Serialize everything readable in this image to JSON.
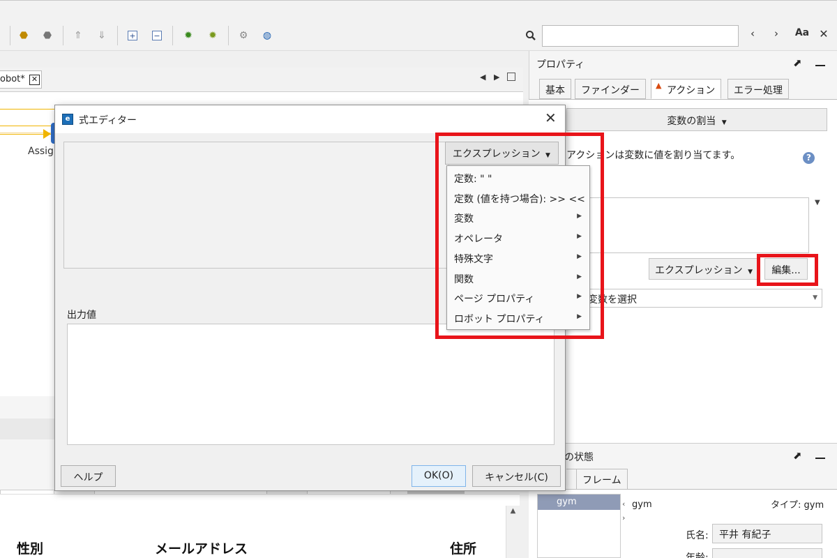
{
  "toolbar": {
    "search_value": "",
    "case_label": "Aa"
  },
  "editor": {
    "tab_label": "obot*",
    "tab_close": "✕",
    "assign_label": "Assig"
  },
  "table": {
    "headers": [
      "性別",
      "メールアドレス",
      "住所"
    ]
  },
  "properties": {
    "title": "プロパティ",
    "tabs": [
      "基本",
      "ファインダー",
      "アクション",
      "エラー処理"
    ],
    "action_dropdown": "変数の割当",
    "description": "アクションは変数に値を割り当てます。",
    "expression_button": "エクスプレッション",
    "edit_button": "編集...",
    "variable_select": "変数を選択"
  },
  "state_panel": {
    "title": "の状態",
    "tab_frame": "フレーム",
    "list_item": "gym",
    "var_name": "gym",
    "type_label": "タイプ: gym",
    "field_label": "氏名:",
    "field_value": "平井 有紀子",
    "field2_label": "年齢:"
  },
  "dialog": {
    "title": "式エディター",
    "expression_button": "エクスプレッション",
    "output_label": "出力値",
    "help_button": "ヘルプ",
    "ok_button": "OK(O)",
    "cancel_button": "キャンセル(C)",
    "menu": {
      "items": [
        {
          "label": "定数: \" \""
        },
        {
          "label": "定数 (値を持つ場合): >> <<"
        },
        {
          "label": "変数"
        },
        {
          "label": "オペレータ"
        },
        {
          "label": "特殊文字"
        },
        {
          "label": "関数"
        },
        {
          "label": "ページ プロパティ"
        },
        {
          "label": "ロボット プロパティ"
        }
      ]
    }
  },
  "colors": {
    "highlight": "#e8141a",
    "selection": "#8f9bb6"
  }
}
